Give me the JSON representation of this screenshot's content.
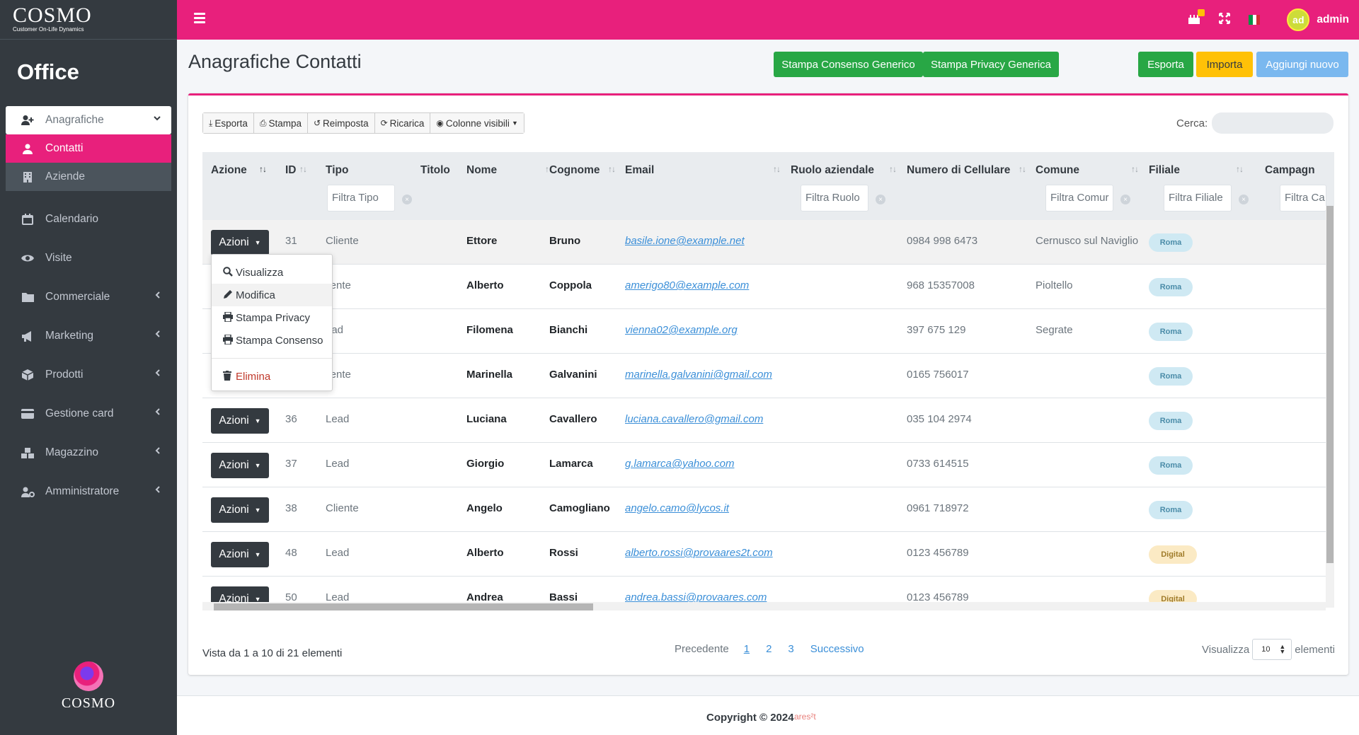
{
  "brand": {
    "name": "COSMO",
    "tagline": "Customer On-Life Dynamics",
    "section": "Office",
    "footer_logo": "COSMO"
  },
  "sidebar": {
    "group": {
      "label": "Anagrafiche",
      "icon": "user-plus-icon"
    },
    "sub_items": [
      {
        "label": "Contatti",
        "icon": "user-icon",
        "active": true
      },
      {
        "label": "Aziende",
        "icon": "building-icon",
        "active": false
      }
    ],
    "items": [
      {
        "label": "Calendario",
        "icon": "calendar-icon",
        "has_children": false
      },
      {
        "label": "Visite",
        "icon": "eye-icon",
        "has_children": false
      },
      {
        "label": "Commerciale",
        "icon": "folder-icon",
        "has_children": true
      },
      {
        "label": "Marketing",
        "icon": "megaphone-icon",
        "has_children": true
      },
      {
        "label": "Prodotti",
        "icon": "box-icon",
        "has_children": true
      },
      {
        "label": "Gestione card",
        "icon": "credit-card-icon",
        "has_children": true
      },
      {
        "label": "Magazzino",
        "icon": "boxes-icon",
        "has_children": true
      },
      {
        "label": "Amministratore",
        "icon": "user-cog-icon",
        "has_children": true
      }
    ]
  },
  "topbar": {
    "avatar_initials": "ad",
    "user": "admin",
    "accent": "#e8207c"
  },
  "page": {
    "title": "Anagrafiche Contatti",
    "buttons": {
      "stampa_consenso": "Stampa Consenso Generico",
      "stampa_privacy": "Stampa Privacy Generica",
      "esporta": "Esporta",
      "importa": "Importa",
      "aggiungi": "Aggiungi nuovo"
    }
  },
  "toolbar": {
    "esporta": "Esporta",
    "stampa": "Stampa",
    "reimposta": "Reimposta",
    "ricarica": "Ricarica",
    "colonne": "Colonne visibili",
    "search_label": "Cerca:"
  },
  "table": {
    "columns": {
      "azione": "Azione",
      "id": "ID",
      "tipo": "Tipo",
      "titolo": "Titolo",
      "nome": "Nome",
      "cognome": "Cognome",
      "email": "Email",
      "ruolo": "Ruolo aziendale",
      "cellulare": "Numero di Cellulare",
      "comune": "Comune",
      "filiale": "Filiale",
      "campagna": "Campagn"
    },
    "filters": {
      "tipo": "Filtra Tipo",
      "ruolo": "Filtra Ruolo",
      "comune": "Filtra Comur",
      "filiale": "Filtra Filiale",
      "campagna": "Filtra Ca"
    },
    "action_label": "Azioni",
    "rows": [
      {
        "id": "31",
        "tipo": "Cliente",
        "nome": "Ettore",
        "cognome": "Bruno",
        "email": "basile.ione@example.net",
        "cellulare": "0984 998 6473",
        "comune": "Cernusco sul Naviglio",
        "filiale": "Roma"
      },
      {
        "id": "",
        "tipo": "liente",
        "nome": "Alberto",
        "cognome": "Coppola",
        "email": "amerigo80@example.com",
        "cellulare": "968 15357008",
        "comune": "Pioltello",
        "filiale": "Roma"
      },
      {
        "id": "",
        "tipo": "ead",
        "nome": "Filomena",
        "cognome": "Bianchi",
        "email": "vienna02@example.org",
        "cellulare": "397 675 129",
        "comune": "Segrate",
        "filiale": "Roma"
      },
      {
        "id": "",
        "tipo": "liente",
        "nome": "Marinella",
        "cognome": "Galvanini",
        "email": "marinella.galvanini@gmail.com",
        "cellulare": "0165 756017",
        "comune": "",
        "filiale": "Roma"
      },
      {
        "id": "36",
        "tipo": "Lead",
        "nome": "Luciana",
        "cognome": "Cavallero",
        "email": "luciana.cavallero@gmail.com",
        "cellulare": "035 104 2974",
        "comune": "",
        "filiale": "Roma"
      },
      {
        "id": "37",
        "tipo": "Lead",
        "nome": "Giorgio",
        "cognome": "Lamarca",
        "email": "g.lamarca@yahoo.com",
        "cellulare": "0733 614515",
        "comune": "",
        "filiale": "Roma"
      },
      {
        "id": "38",
        "tipo": "Cliente",
        "nome": "Angelo",
        "cognome": "Camogliano",
        "email": "angelo.camo@lycos.it",
        "cellulare": "0961 718972",
        "comune": "",
        "filiale": "Roma"
      },
      {
        "id": "48",
        "tipo": "Lead",
        "nome": "Alberto",
        "cognome": "Rossi",
        "email": "alberto.rossi@provaares2t.com",
        "cellulare": "0123 456789",
        "comune": "",
        "filiale": "Digital"
      },
      {
        "id": "50",
        "tipo": "Lead",
        "nome": "Andrea",
        "cognome": "Bassi",
        "email": "andrea.bassi@provaares.com",
        "cellulare": "0123 456789",
        "comune": "",
        "filiale": "Digital"
      }
    ]
  },
  "dropdown": {
    "items": [
      {
        "label": "Visualizza",
        "icon": "search-icon"
      },
      {
        "label": "Modifica",
        "icon": "pencil-icon"
      },
      {
        "label": "Stampa Privacy",
        "icon": "printer-icon"
      },
      {
        "label": "Stampa Consenso",
        "icon": "printer-icon"
      }
    ],
    "danger": {
      "label": "Elimina",
      "icon": "trash-icon"
    }
  },
  "footer": {
    "info": "Vista da 1 a 10 di 21 elementi",
    "prev": "Precedente",
    "pages": [
      "1",
      "2",
      "3"
    ],
    "next": "Successivo",
    "show_label": "Visualizza",
    "page_size": "10",
    "elements_label": "elementi",
    "copyright": "Copyright © 2024",
    "ares": "ares²t"
  }
}
